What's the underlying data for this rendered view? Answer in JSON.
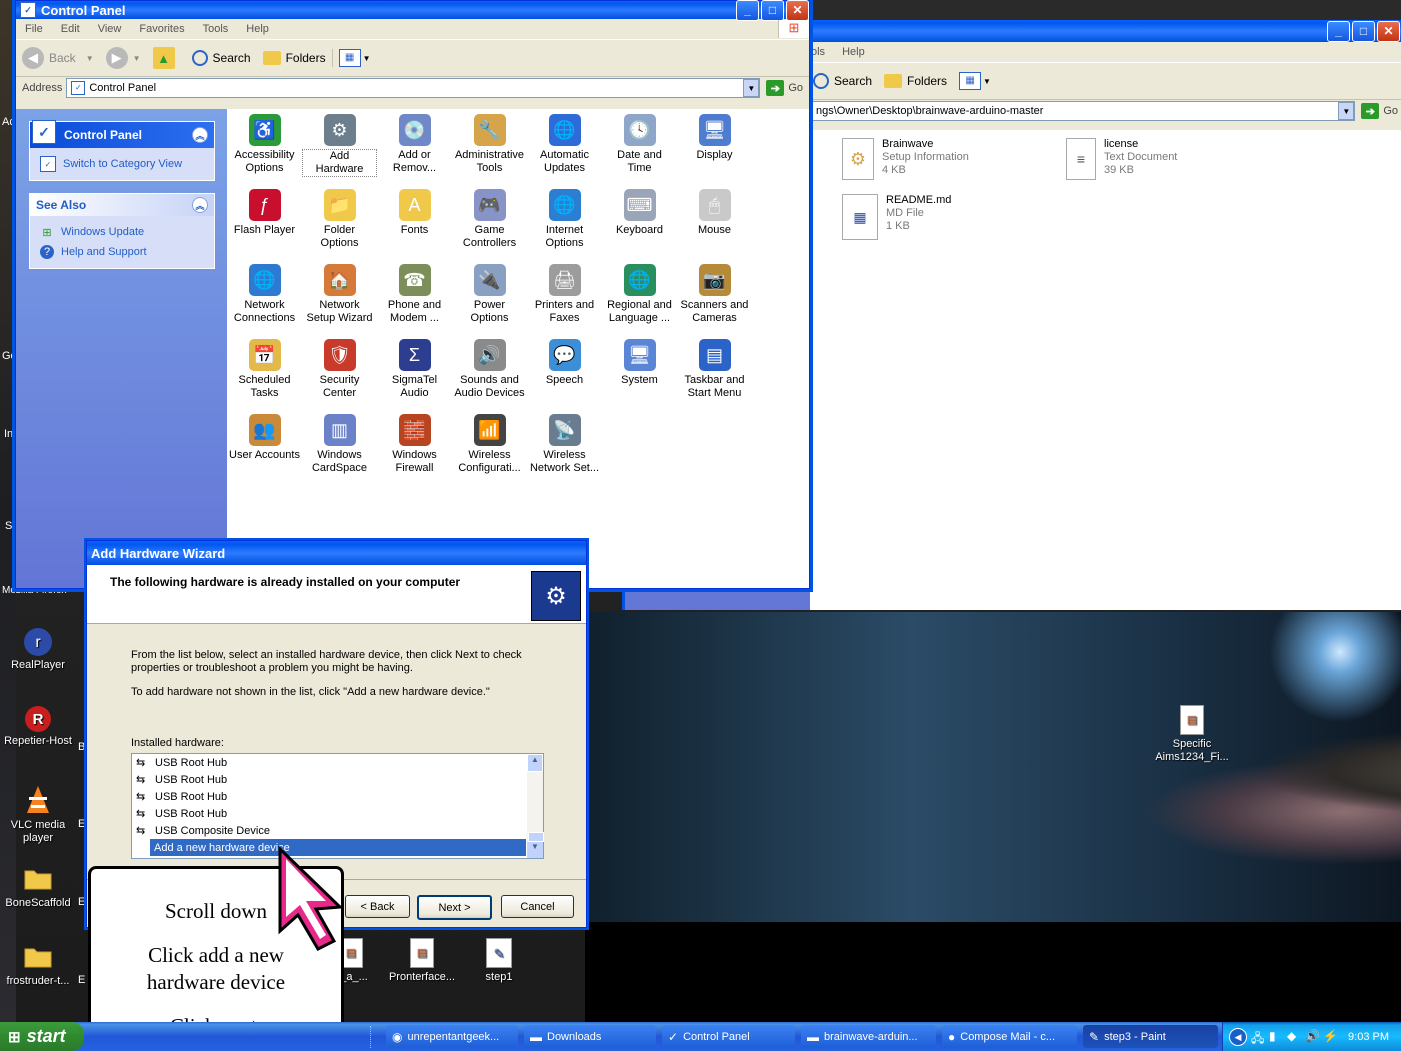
{
  "desktop": {
    "icons": [
      {
        "label": "RealPlayer",
        "icon": "realplayer-icon"
      },
      {
        "label": "Repetier-Host",
        "icon": "repetier-icon"
      },
      {
        "label": "VLC media player",
        "icon": "vlc-icon"
      },
      {
        "label": "BoneScaffold",
        "icon": "folder-icon"
      },
      {
        "label": "frostruder-t...",
        "icon": "folder-icon"
      }
    ],
    "partial_labels": [
      "Ac",
      "Go",
      "In",
      "S",
      "Mozilla Firefox",
      "B",
      "E",
      "E",
      "E"
    ],
    "bottom_icons": [
      {
        "label": "g_a_...",
        "icon": "document-icon"
      },
      {
        "label": "Pronterface...",
        "icon": "pronterface-icon"
      },
      {
        "label": "step1",
        "icon": "paint-image-icon"
      }
    ],
    "right_icon": {
      "label": "Specific Aims1234_Fi...",
      "icon": "document-icon"
    }
  },
  "control_panel": {
    "title": "Control Panel",
    "menu": [
      "File",
      "Edit",
      "View",
      "Favorites",
      "Tools",
      "Help"
    ],
    "toolbar": {
      "back": "Back",
      "search": "Search",
      "folders": "Folders"
    },
    "address_label": "Address",
    "address_value": "Control Panel",
    "go_label": "Go",
    "panel_title": "Control Panel",
    "switch_view": "Switch to Category View",
    "see_also_title": "See Also",
    "see_also": [
      "Windows Update",
      "Help and Support"
    ],
    "items": [
      {
        "label": "Accessibility Options",
        "color": "#2b9a39",
        "glyph": "♿"
      },
      {
        "label": "Add Hardware",
        "color": "#6d7f8c",
        "glyph": "⚙"
      },
      {
        "label": "Add or Remov...",
        "color": "#6f89c8",
        "glyph": "💿"
      },
      {
        "label": "Administrative Tools",
        "color": "#d6a54b",
        "glyph": "🔧"
      },
      {
        "label": "Automatic Updates",
        "color": "#2f6ad9",
        "glyph": "🌐"
      },
      {
        "label": "Date and Time",
        "color": "#8fa6c8",
        "glyph": "🕓"
      },
      {
        "label": "Display",
        "color": "#4e7ccf",
        "glyph": "🖥"
      },
      {
        "label": "Flash Player",
        "color": "#c8102e",
        "glyph": "ƒ"
      },
      {
        "label": "Folder Options",
        "color": "#f0c94a",
        "glyph": "📁"
      },
      {
        "label": "Fonts",
        "color": "#f0c94a",
        "glyph": "A"
      },
      {
        "label": "Game Controllers",
        "color": "#8894c8",
        "glyph": "🎮"
      },
      {
        "label": "Internet Options",
        "color": "#2c7fd0",
        "glyph": "🌐"
      },
      {
        "label": "Keyboard",
        "color": "#9aa5b8",
        "glyph": "⌨"
      },
      {
        "label": "Mouse",
        "color": "#c9c9c9",
        "glyph": "🖱"
      },
      {
        "label": "Network Connections",
        "color": "#2f7ad1",
        "glyph": "🌐"
      },
      {
        "label": "Network Setup Wizard",
        "color": "#d67a3a",
        "glyph": "🏠"
      },
      {
        "label": "Phone and Modem ...",
        "color": "#7c8f5a",
        "glyph": "☎"
      },
      {
        "label": "Power Options",
        "color": "#8aa0c2",
        "glyph": "🔌"
      },
      {
        "label": "Printers and Faxes",
        "color": "#9c9c9c",
        "glyph": "🖨"
      },
      {
        "label": "Regional and Language ...",
        "color": "#2a8f5f",
        "glyph": "🌐"
      },
      {
        "label": "Scanners and Cameras",
        "color": "#b58b3a",
        "glyph": "📷"
      },
      {
        "label": "Scheduled Tasks",
        "color": "#e3b94a",
        "glyph": "📅"
      },
      {
        "label": "Security Center",
        "color": "#c83a2a",
        "glyph": "🛡"
      },
      {
        "label": "SigmaTel Audio",
        "color": "#2d3d8f",
        "glyph": "Σ"
      },
      {
        "label": "Sounds and Audio Devices",
        "color": "#8a8a8a",
        "glyph": "🔊"
      },
      {
        "label": "Speech",
        "color": "#3c8fd6",
        "glyph": "💬"
      },
      {
        "label": "System",
        "color": "#5b86d6",
        "glyph": "🖥"
      },
      {
        "label": "Taskbar and Start Menu",
        "color": "#2c63c8",
        "glyph": "▤"
      },
      {
        "label": "User Accounts",
        "color": "#c98a3a",
        "glyph": "👥"
      },
      {
        "label": "Windows CardSpace",
        "color": "#6b82c9",
        "glyph": "▥"
      },
      {
        "label": "Windows Firewall",
        "color": "#b84522",
        "glyph": "🧱"
      },
      {
        "label": "Wireless Configurati...",
        "color": "#444",
        "glyph": "📶"
      },
      {
        "label": "Wireless Network Set...",
        "color": "#6a7c8f",
        "glyph": "📡"
      }
    ]
  },
  "explorer": {
    "menu": [
      "ols",
      "Help"
    ],
    "toolbar": {
      "search": "Search",
      "folders": "Folders"
    },
    "address_value": "ngs\\Owner\\Desktop\\brainwave-arduino-master",
    "go_label": "Go",
    "files": [
      {
        "name": "Brainwave",
        "type": "Setup Information",
        "size": "4 KB",
        "icon": "setup-info-icon"
      },
      {
        "name": "license",
        "type": "Text Document",
        "size": "39 KB",
        "icon": "text-document-icon"
      },
      {
        "name": "README.md",
        "type": "MD File",
        "size": "1 KB",
        "icon": "md-file-icon"
      }
    ]
  },
  "wizard": {
    "title": "Add Hardware Wizard",
    "heading": "The following hardware is already installed on your computer",
    "instruction1": "From the list below, select an installed hardware device, then click Next to check properties or troubleshoot a problem you might be having.",
    "instruction2": "To add hardware not shown in the list, click \"Add a new hardware device.\"",
    "list_label": "Installed hardware:",
    "list_items": [
      "USB Root Hub",
      "USB Root Hub",
      "USB Root Hub",
      "USB Root Hub",
      "USB Composite Device",
      "Add a new hardware device"
    ],
    "selected_index": 5,
    "back_label": "< Back",
    "next_label": "Next >",
    "cancel_label": "Cancel"
  },
  "callout": {
    "line1": "Scroll down",
    "line2": "Click add a new hardware device",
    "line3": "Click next."
  },
  "taskbar": {
    "start_label": "start",
    "items": [
      {
        "label": "unrepentantgeek...",
        "icon": "chrome-icon"
      },
      {
        "label": "Downloads",
        "icon": "folder-icon"
      },
      {
        "label": "Control Panel",
        "icon": "control-panel-icon"
      },
      {
        "label": "brainwave-arduin...",
        "icon": "folder-icon"
      },
      {
        "label": "Compose Mail - c...",
        "icon": "firefox-icon"
      },
      {
        "label": "step3 - Paint",
        "icon": "paint-icon"
      }
    ],
    "active_index": 5,
    "clock": "9:03 PM"
  },
  "colors": {
    "xp_blue": "#0054e3",
    "selection": "#316ac5",
    "taskbar": "#245edb",
    "start_green": "#3c9c3c"
  }
}
